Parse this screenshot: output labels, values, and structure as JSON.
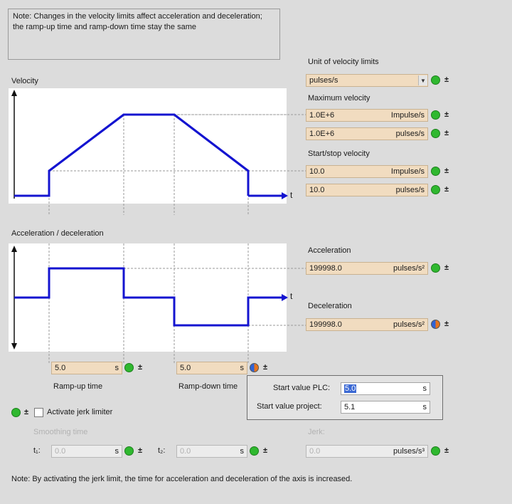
{
  "note_top": "Note: Changes in the velocity limits affect acceleration and deceleration; the ramp-up time and ramp-down time stay the same",
  "velocity_chart_label": "Velocity",
  "accel_chart_label": "Acceleration / deceleration",
  "axis_t": "t",
  "unit_of_velocity_limits": {
    "label": "Unit of velocity limits",
    "value": "pulses/s"
  },
  "max_velocity": {
    "label": "Maximum velocity",
    "fields": [
      {
        "value": "1.0E+6",
        "unit": "Impulse/s"
      },
      {
        "value": "1.0E+6",
        "unit": "pulses/s"
      }
    ]
  },
  "start_stop_velocity": {
    "label": "Start/stop velocity",
    "fields": [
      {
        "value": "10.0",
        "unit": "Impulse/s"
      },
      {
        "value": "10.0",
        "unit": "pulses/s"
      }
    ]
  },
  "acceleration": {
    "label": "Acceleration",
    "value": "199998.0",
    "unit": "pulses/s²"
  },
  "deceleration": {
    "label": "Deceleration",
    "value": "199998.0",
    "unit": "pulses/s²"
  },
  "ramp_up": {
    "label": "Ramp-up time",
    "value": "5.0",
    "unit": "s"
  },
  "ramp_down": {
    "label": "Ramp-down time",
    "value": "5.0",
    "unit": "s"
  },
  "popup": {
    "plc_label": "Start value PLC:",
    "plc_value": "5.0",
    "plc_unit": "s",
    "project_label": "Start value project:",
    "project_value": "5.1",
    "project_unit": "s"
  },
  "jerk_limiter_label": "Activate jerk limiter",
  "smoothing_time_label": "Smoothing time",
  "t1_label": "t₁:",
  "t2_label": "t₂:",
  "t1_value": "0.0",
  "t2_value": "0.0",
  "smoothing_unit": "s",
  "jerk_label": "Jerk:",
  "jerk_value": "0.0",
  "jerk_unit": "pulses/s³",
  "note_bottom": "Note: By activating the jerk limit, the time for acceleration and deceleration of the axis is increased."
}
